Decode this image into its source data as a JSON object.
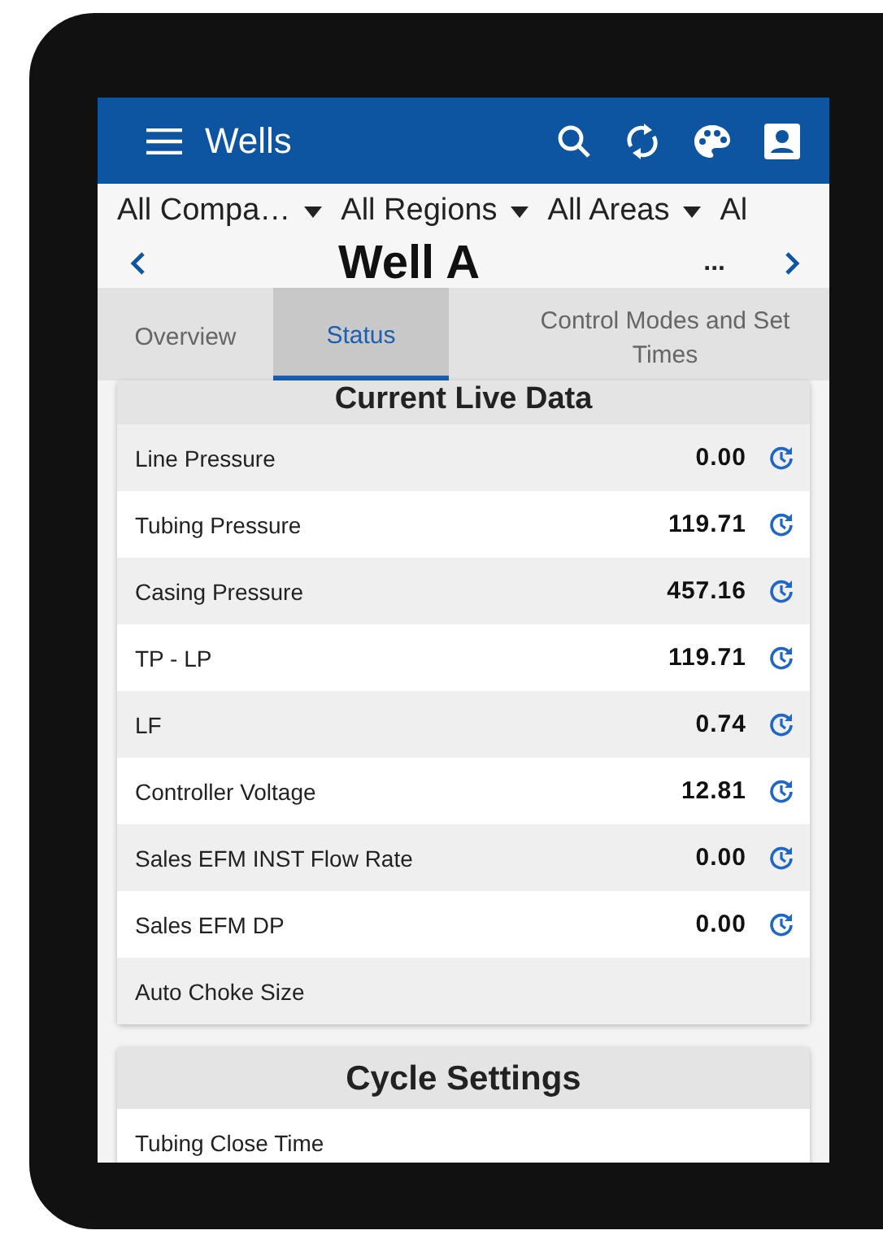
{
  "app_bar": {
    "title": "Wells"
  },
  "filters": [
    {
      "label": "All Compa…",
      "dropdown": true
    },
    {
      "label": "All Regions",
      "dropdown": true
    },
    {
      "label": "All Areas",
      "dropdown": true
    },
    {
      "label": "Al",
      "dropdown": false
    }
  ],
  "well_nav": {
    "title": "Well A",
    "more": "..."
  },
  "tabs": [
    {
      "label": "Overview",
      "selected": false
    },
    {
      "label": "Status",
      "selected": true
    },
    {
      "label": "Control Modes and Set Times",
      "selected": false
    }
  ],
  "live_data": {
    "title": "Current Live Data",
    "rows": [
      {
        "label": "Line Pressure",
        "value": "0.00"
      },
      {
        "label": "Tubing Pressure",
        "value": "119.71"
      },
      {
        "label": "Casing Pressure",
        "value": "457.16"
      },
      {
        "label": "TP - LP",
        "value": "119.71"
      },
      {
        "label": "LF",
        "value": "0.74"
      },
      {
        "label": "Controller Voltage",
        "value": "12.81"
      },
      {
        "label": "Sales EFM INST Flow Rate",
        "value": "0.00"
      },
      {
        "label": "Sales EFM DP",
        "value": "0.00"
      },
      {
        "label": "Auto Choke Size"
      }
    ]
  },
  "cycle_settings": {
    "title": "Cycle Settings",
    "rows": [
      {
        "label": "Tubing Close Time"
      }
    ]
  }
}
